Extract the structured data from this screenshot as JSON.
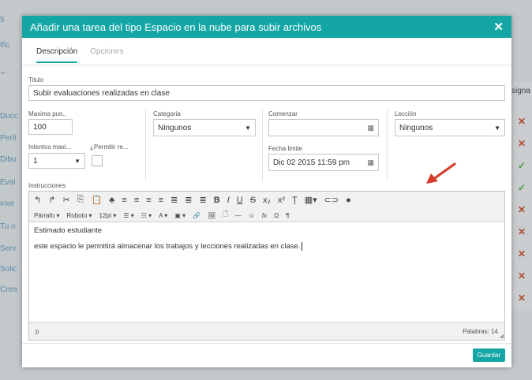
{
  "background": {
    "left_items": [
      "5",
      "ific",
      "←",
      "Ducc",
      "Perfi",
      "Dibu",
      "Eval",
      "inve",
      "Tu o",
      "Serv",
      "Solic",
      "Crea"
    ],
    "right_header": "signa",
    "right_marks": [
      "✕",
      "✕",
      "✓",
      "✓",
      "✕",
      "✕",
      "✕",
      "✕",
      "✕"
    ]
  },
  "modal": {
    "title": "Añadir una tarea del tipo Espacio en la nube para subir archivos",
    "close": "✕",
    "tabs": [
      {
        "label": "Descripción",
        "active": true
      },
      {
        "label": "Opciones",
        "active": false
      }
    ],
    "form": {
      "titulo_label": "Titulo",
      "titulo_value": "Subir evaluaciones realizadas en clase",
      "max_puntos_label": "Maxima pun..",
      "max_puntos_value": "100",
      "intentos_label": "Intentos maxi...",
      "intentos_value": "1",
      "permitir_label": "¿Permitir re...",
      "categoria_label": "Categoria",
      "categoria_value": "Ningunos",
      "comenzar_label": "Comenzar",
      "comenzar_value": "",
      "fecha_limite_label": "Fecha limite",
      "fecha_limite_value": "Dic 02 2015 11:59 pm",
      "leccion_label": "Lección",
      "leccion_value": "Ningunos",
      "instrucciones_label": "Instrucciones"
    },
    "editor": {
      "toolbar_row1": [
        "↰",
        "↱",
        "✂",
        "⎘",
        "📋",
        "♣",
        "≡",
        "≡",
        "≡",
        "≡",
        "≣",
        "≣",
        "≣",
        "B",
        "I",
        "U",
        "S",
        "x₂",
        "x²",
        "Ṯ",
        "▦▾",
        "⊂⊃",
        "●"
      ],
      "toolbar_row2": [
        "Párrafo ▾",
        "Roboto ▾",
        "12pt ▾",
        "☰ ▾",
        "☷ ▾",
        "A ▾",
        "▣ ▾",
        "🔗",
        "🖼",
        "🗋",
        "—",
        "☺",
        "fx",
        "Ω",
        "¶"
      ],
      "line1": "Estimado estudiante",
      "line2": "este espacio le permitirá almacenar los trabajos y lecciones realizadas en clase.",
      "status_path": "p",
      "word_count": "Palabras: 14"
    },
    "save_label": "Guardar"
  },
  "colors": {
    "header": "#14a6a5",
    "arrow": "#d63a2a"
  }
}
